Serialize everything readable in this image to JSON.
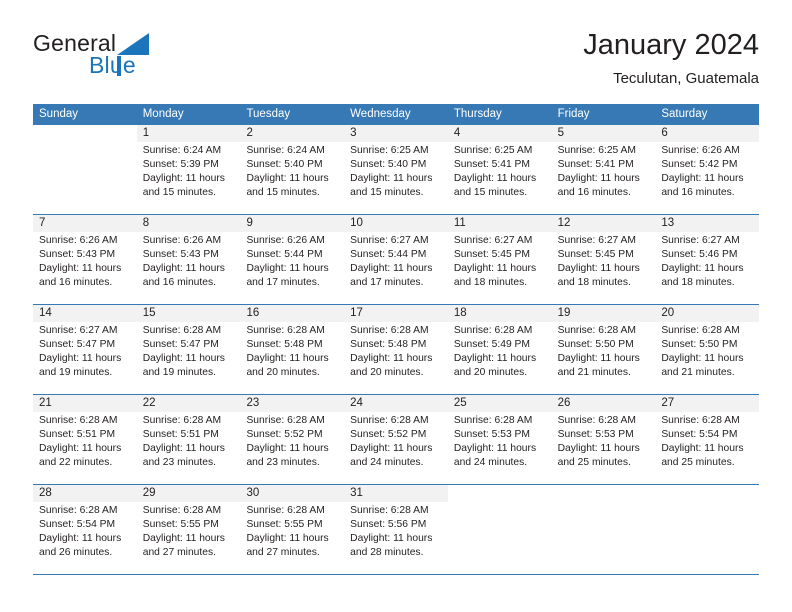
{
  "brand": {
    "name_part1": "General",
    "name_part2": "Blue"
  },
  "header": {
    "month_title": "January 2024",
    "location": "Teculutan, Guatemala"
  },
  "colors": {
    "header_blue": "#3679b5",
    "brand_blue": "#1b75bb",
    "day_band_gray": "#f2f2f2",
    "text": "#231f20"
  },
  "weekday_headers": [
    "Sunday",
    "Monday",
    "Tuesday",
    "Wednesday",
    "Thursday",
    "Friday",
    "Saturday"
  ],
  "weeks": [
    [
      {
        "day": "",
        "sunrise": "",
        "sunset": "",
        "daylight": "",
        "empty": true
      },
      {
        "day": "1",
        "sunrise": "Sunrise: 6:24 AM",
        "sunset": "Sunset: 5:39 PM",
        "daylight": "Daylight: 11 hours and 15 minutes."
      },
      {
        "day": "2",
        "sunrise": "Sunrise: 6:24 AM",
        "sunset": "Sunset: 5:40 PM",
        "daylight": "Daylight: 11 hours and 15 minutes."
      },
      {
        "day": "3",
        "sunrise": "Sunrise: 6:25 AM",
        "sunset": "Sunset: 5:40 PM",
        "daylight": "Daylight: 11 hours and 15 minutes."
      },
      {
        "day": "4",
        "sunrise": "Sunrise: 6:25 AM",
        "sunset": "Sunset: 5:41 PM",
        "daylight": "Daylight: 11 hours and 15 minutes."
      },
      {
        "day": "5",
        "sunrise": "Sunrise: 6:25 AM",
        "sunset": "Sunset: 5:41 PM",
        "daylight": "Daylight: 11 hours and 16 minutes."
      },
      {
        "day": "6",
        "sunrise": "Sunrise: 6:26 AM",
        "sunset": "Sunset: 5:42 PM",
        "daylight": "Daylight: 11 hours and 16 minutes."
      }
    ],
    [
      {
        "day": "7",
        "sunrise": "Sunrise: 6:26 AM",
        "sunset": "Sunset: 5:43 PM",
        "daylight": "Daylight: 11 hours and 16 minutes."
      },
      {
        "day": "8",
        "sunrise": "Sunrise: 6:26 AM",
        "sunset": "Sunset: 5:43 PM",
        "daylight": "Daylight: 11 hours and 16 minutes."
      },
      {
        "day": "9",
        "sunrise": "Sunrise: 6:26 AM",
        "sunset": "Sunset: 5:44 PM",
        "daylight": "Daylight: 11 hours and 17 minutes."
      },
      {
        "day": "10",
        "sunrise": "Sunrise: 6:27 AM",
        "sunset": "Sunset: 5:44 PM",
        "daylight": "Daylight: 11 hours and 17 minutes."
      },
      {
        "day": "11",
        "sunrise": "Sunrise: 6:27 AM",
        "sunset": "Sunset: 5:45 PM",
        "daylight": "Daylight: 11 hours and 18 minutes."
      },
      {
        "day": "12",
        "sunrise": "Sunrise: 6:27 AM",
        "sunset": "Sunset: 5:45 PM",
        "daylight": "Daylight: 11 hours and 18 minutes."
      },
      {
        "day": "13",
        "sunrise": "Sunrise: 6:27 AM",
        "sunset": "Sunset: 5:46 PM",
        "daylight": "Daylight: 11 hours and 18 minutes."
      }
    ],
    [
      {
        "day": "14",
        "sunrise": "Sunrise: 6:27 AM",
        "sunset": "Sunset: 5:47 PM",
        "daylight": "Daylight: 11 hours and 19 minutes."
      },
      {
        "day": "15",
        "sunrise": "Sunrise: 6:28 AM",
        "sunset": "Sunset: 5:47 PM",
        "daylight": "Daylight: 11 hours and 19 minutes."
      },
      {
        "day": "16",
        "sunrise": "Sunrise: 6:28 AM",
        "sunset": "Sunset: 5:48 PM",
        "daylight": "Daylight: 11 hours and 20 minutes."
      },
      {
        "day": "17",
        "sunrise": "Sunrise: 6:28 AM",
        "sunset": "Sunset: 5:48 PM",
        "daylight": "Daylight: 11 hours and 20 minutes."
      },
      {
        "day": "18",
        "sunrise": "Sunrise: 6:28 AM",
        "sunset": "Sunset: 5:49 PM",
        "daylight": "Daylight: 11 hours and 20 minutes."
      },
      {
        "day": "19",
        "sunrise": "Sunrise: 6:28 AM",
        "sunset": "Sunset: 5:50 PM",
        "daylight": "Daylight: 11 hours and 21 minutes."
      },
      {
        "day": "20",
        "sunrise": "Sunrise: 6:28 AM",
        "sunset": "Sunset: 5:50 PM",
        "daylight": "Daylight: 11 hours and 21 minutes."
      }
    ],
    [
      {
        "day": "21",
        "sunrise": "Sunrise: 6:28 AM",
        "sunset": "Sunset: 5:51 PM",
        "daylight": "Daylight: 11 hours and 22 minutes."
      },
      {
        "day": "22",
        "sunrise": "Sunrise: 6:28 AM",
        "sunset": "Sunset: 5:51 PM",
        "daylight": "Daylight: 11 hours and 23 minutes."
      },
      {
        "day": "23",
        "sunrise": "Sunrise: 6:28 AM",
        "sunset": "Sunset: 5:52 PM",
        "daylight": "Daylight: 11 hours and 23 minutes."
      },
      {
        "day": "24",
        "sunrise": "Sunrise: 6:28 AM",
        "sunset": "Sunset: 5:52 PM",
        "daylight": "Daylight: 11 hours and 24 minutes."
      },
      {
        "day": "25",
        "sunrise": "Sunrise: 6:28 AM",
        "sunset": "Sunset: 5:53 PM",
        "daylight": "Daylight: 11 hours and 24 minutes."
      },
      {
        "day": "26",
        "sunrise": "Sunrise: 6:28 AM",
        "sunset": "Sunset: 5:53 PM",
        "daylight": "Daylight: 11 hours and 25 minutes."
      },
      {
        "day": "27",
        "sunrise": "Sunrise: 6:28 AM",
        "sunset": "Sunset: 5:54 PM",
        "daylight": "Daylight: 11 hours and 25 minutes."
      }
    ],
    [
      {
        "day": "28",
        "sunrise": "Sunrise: 6:28 AM",
        "sunset": "Sunset: 5:54 PM",
        "daylight": "Daylight: 11 hours and 26 minutes."
      },
      {
        "day": "29",
        "sunrise": "Sunrise: 6:28 AM",
        "sunset": "Sunset: 5:55 PM",
        "daylight": "Daylight: 11 hours and 27 minutes."
      },
      {
        "day": "30",
        "sunrise": "Sunrise: 6:28 AM",
        "sunset": "Sunset: 5:55 PM",
        "daylight": "Daylight: 11 hours and 27 minutes."
      },
      {
        "day": "31",
        "sunrise": "Sunrise: 6:28 AM",
        "sunset": "Sunset: 5:56 PM",
        "daylight": "Daylight: 11 hours and 28 minutes."
      },
      {
        "day": "",
        "sunrise": "",
        "sunset": "",
        "daylight": "",
        "empty": true
      },
      {
        "day": "",
        "sunrise": "",
        "sunset": "",
        "daylight": "",
        "empty": true
      },
      {
        "day": "",
        "sunrise": "",
        "sunset": "",
        "daylight": "",
        "empty": true
      }
    ]
  ]
}
